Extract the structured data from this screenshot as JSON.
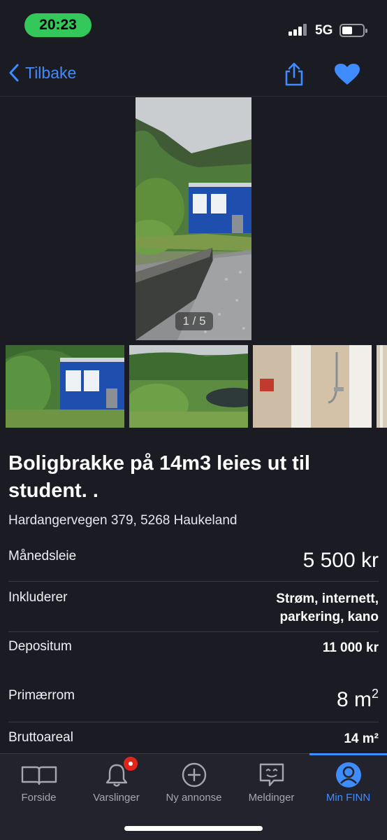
{
  "status_bar": {
    "time": "20:23",
    "network": "5G",
    "time_color": "#34c759"
  },
  "nav": {
    "back_label": "Tilbake",
    "share_icon": "share-icon",
    "favorite_icon": "heart-icon",
    "accent": "#3f8cff"
  },
  "gallery": {
    "counter": "1 / 5"
  },
  "listing": {
    "title": "Boligbrakke på 14m3 leies ut til student. .",
    "address": "Hardangervegen 379, 5268 Haukeland"
  },
  "details": {
    "rent_label": "Månedsleie",
    "rent_value": "5 500 kr",
    "includes_label": "Inkluderer",
    "includes_line1": "Strøm, internett,",
    "includes_line2": "parkering, kano",
    "deposit_label": "Depositum",
    "deposit_value": "11 000 kr",
    "primary_label": "Primærrom",
    "primary_value": "8 m",
    "primary_unit": "2",
    "gross_label": "Bruttoareal",
    "gross_value": "14 m²"
  },
  "tabs": [
    {
      "label": "Forside",
      "icon": "book-icon"
    },
    {
      "label": "Varslinger",
      "icon": "bell-icon"
    },
    {
      "label": "Ny annonse",
      "icon": "plus-circle-icon"
    },
    {
      "label": "Meldinger",
      "icon": "chat-icon"
    },
    {
      "label": "Min FINN",
      "icon": "profile-icon",
      "active": true
    }
  ]
}
